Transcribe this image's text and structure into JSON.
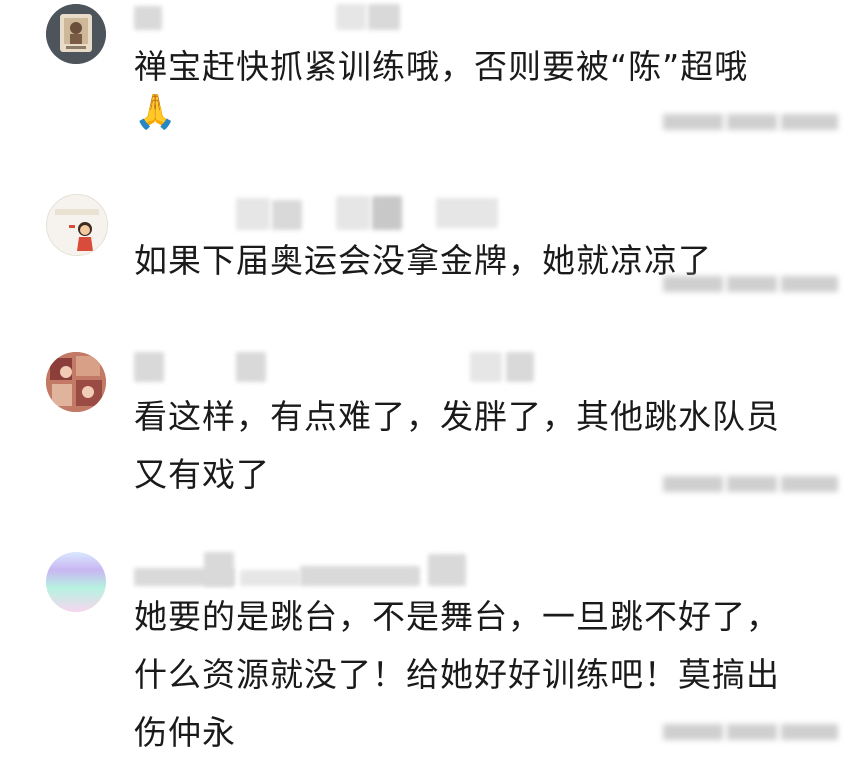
{
  "comments": [
    {
      "text": "禅宝赶快抓紧训练哦，否则要被“陈”超哦",
      "emoji": "🙏"
    },
    {
      "text": "如果下届奥运会没拿金牌，她就凉凉了"
    },
    {
      "text": "看这样，有点难了，发胖了，其他跳水队员\n又有戏了"
    },
    {
      "text": "她要的是跳台，不是舞台，一旦跳不好了，\n什么资源就没了！给她好好训练吧！莫搞出\n伤仲永"
    }
  ],
  "icons": {
    "avatar1": "avatar-portrait-icon",
    "avatar2": "avatar-cartoon-girl-icon",
    "avatar3": "avatar-photo-icon",
    "avatar4": "avatar-gradient-icon",
    "emoji1": "folded-hands-emoji"
  }
}
